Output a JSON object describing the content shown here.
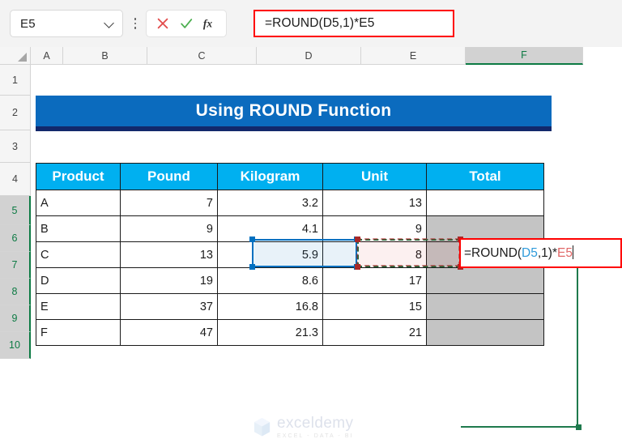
{
  "formula_bar": {
    "name_box_value": "E5",
    "name_box_icon": "chevron-down-icon",
    "more_icon": "kebab-menu-icon",
    "cancel_icon": "cancel-x-icon",
    "confirm_icon": "confirm-check-icon",
    "function_icon": "insert-function-fx-icon",
    "formula_value": "=ROUND(D5,1)*E5",
    "highlight_color": "#ff0000"
  },
  "grid": {
    "columns": [
      "A",
      "B",
      "C",
      "D",
      "E",
      "F"
    ],
    "active_column": "F",
    "rows": [
      "1",
      "2",
      "3",
      "4",
      "5",
      "6",
      "7",
      "8",
      "9",
      "10"
    ],
    "active_rows": [
      "5",
      "6",
      "7",
      "8",
      "9",
      "10"
    ],
    "selection_color": "#1f7a4d"
  },
  "title_banner": {
    "text": "Using ROUND Function",
    "background": "#0b6bbe",
    "underline": "#12286b",
    "text_color": "#ffffff"
  },
  "table": {
    "header_background": "#00b0f0",
    "header_text_color": "#ffffff",
    "headers": [
      "Product",
      "Pound",
      "Kilogram",
      "Unit",
      "Total"
    ],
    "rows": [
      {
        "product": "A",
        "pound": "7",
        "kilogram": "3.2",
        "unit": "13",
        "total": ""
      },
      {
        "product": "B",
        "pound": "9",
        "kilogram": "4.1",
        "unit": "9",
        "total": ""
      },
      {
        "product": "C",
        "pound": "13",
        "kilogram": "5.9",
        "unit": "8",
        "total": ""
      },
      {
        "product": "D",
        "pound": "19",
        "kilogram": "8.6",
        "unit": "17",
        "total": ""
      },
      {
        "product": "E",
        "pound": "37",
        "kilogram": "16.8",
        "unit": "15",
        "total": ""
      },
      {
        "product": "F",
        "pound": "47",
        "kilogram": "21.3",
        "unit": "21",
        "total": ""
      }
    ]
  },
  "cell_editor": {
    "prefix": "=ROUND(",
    "ref_first": "D5",
    "middle": ",1)*",
    "ref_second": "E5",
    "ref_first_color": "#2f9bdb",
    "ref_second_color": "#e06666",
    "border_color": "#ff0000"
  },
  "precedents": {
    "blue_ref_cell": "D5",
    "blue_color": "#0070c0",
    "red_ref_cell": "E5",
    "red_color": "#a82828"
  },
  "watermark": {
    "name": "exceldemy",
    "tagline": "EXCEL - DATA - BI",
    "icon": "exceldemy-cube-logo-icon"
  }
}
